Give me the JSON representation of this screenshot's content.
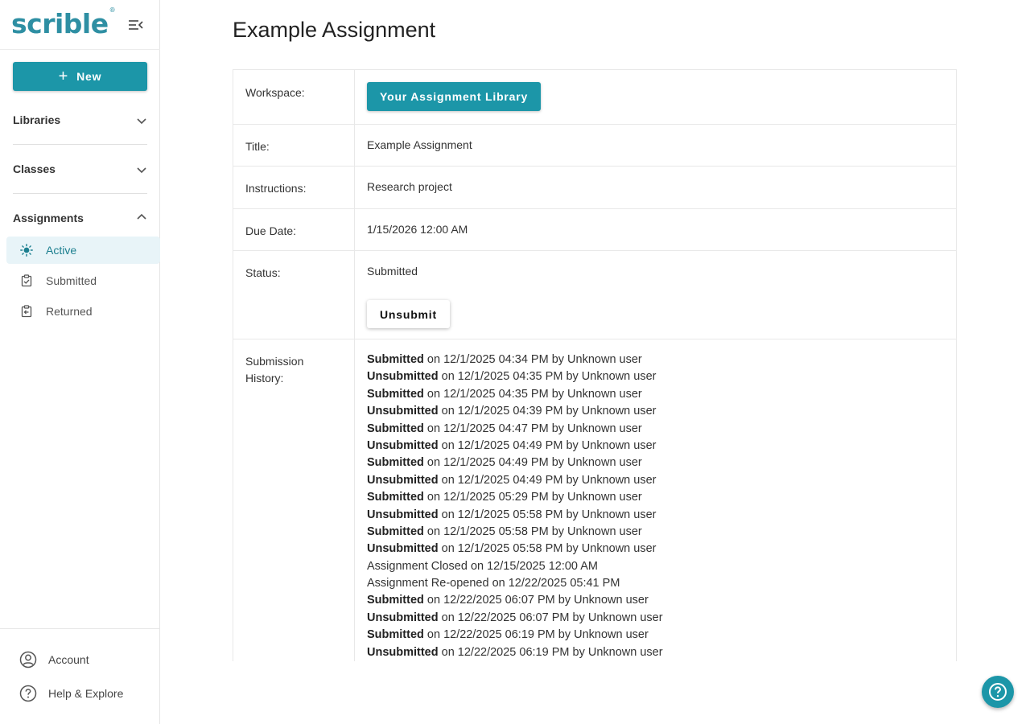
{
  "sidebar": {
    "logo_text": "scrible",
    "logo_mark": "®",
    "new_label": "New",
    "sections": [
      {
        "label": "Libraries"
      },
      {
        "label": "Classes"
      },
      {
        "label": "Assignments"
      }
    ],
    "assignment_items": [
      {
        "label": "Active",
        "icon": "sun-icon",
        "active": true
      },
      {
        "label": "Submitted",
        "icon": "clipboard-check-icon"
      },
      {
        "label": "Returned",
        "icon": "clipboard-return-icon"
      }
    ],
    "bottom": [
      {
        "label": "Account",
        "icon": "account-icon"
      },
      {
        "label": "Help & Explore",
        "icon": "help-icon"
      }
    ]
  },
  "main": {
    "title": "Example Assignment",
    "rows": {
      "workspace_label": "Workspace:",
      "workspace_button": "Your Assignment Library",
      "title_label": "Title:",
      "title_value": "Example Assignment",
      "instructions_label": "Instructions:",
      "instructions_value": "Research project",
      "due_label": "Due Date:",
      "due_value": "1/15/2026 12:00 AM",
      "status_label": "Status:",
      "status_value": "Submitted",
      "unsubmit_button": "Unsubmit",
      "history_label": "Submission History:"
    },
    "history": [
      {
        "action": "Submitted",
        "date": "on 12/1/2025 04:34 PM",
        "by": "by Unknown user",
        "bold": true
      },
      {
        "action": "Unsubmitted",
        "date": "on 12/1/2025 04:35 PM",
        "by": "by Unknown user",
        "bold": true
      },
      {
        "action": "Submitted",
        "date": "on 12/1/2025 04:35 PM",
        "by": "by Unknown user",
        "bold": true
      },
      {
        "action": "Unsubmitted",
        "date": "on 12/1/2025 04:39 PM",
        "by": "by Unknown user",
        "bold": true
      },
      {
        "action": "Submitted",
        "date": "on 12/1/2025 04:47 PM",
        "by": "by Unknown user",
        "bold": true
      },
      {
        "action": "Unsubmitted",
        "date": "on 12/1/2025 04:49 PM",
        "by": "by Unknown user",
        "bold": true
      },
      {
        "action": "Submitted",
        "date": "on 12/1/2025 04:49 PM",
        "by": "by Unknown user",
        "bold": true
      },
      {
        "action": "Unsubmitted",
        "date": "on 12/1/2025 04:49 PM",
        "by": "by Unknown user",
        "bold": true
      },
      {
        "action": "Submitted",
        "date": "on 12/1/2025 05:29 PM",
        "by": "by Unknown user",
        "bold": true
      },
      {
        "action": "Unsubmitted",
        "date": "on 12/1/2025 05:58 PM",
        "by": "by Unknown user",
        "bold": true
      },
      {
        "action": "Submitted",
        "date": "on 12/1/2025 05:58 PM",
        "by": "by Unknown user",
        "bold": true
      },
      {
        "action": "Unsubmitted",
        "date": "on 12/1/2025 05:58 PM",
        "by": "by Unknown user",
        "bold": true
      },
      {
        "action": "Assignment Closed",
        "date": "on 12/15/2025 12:00 AM",
        "by": "",
        "bold": false
      },
      {
        "action": "Assignment Re-opened",
        "date": "on 12/22/2025 05:41 PM",
        "by": "",
        "bold": false
      },
      {
        "action": "Submitted",
        "date": "on 12/22/2025 06:07 PM",
        "by": "by Unknown user",
        "bold": true
      },
      {
        "action": "Unsubmitted",
        "date": "on 12/22/2025 06:07 PM",
        "by": "by Unknown user",
        "bold": true
      },
      {
        "action": "Submitted",
        "date": "on 12/22/2025 06:19 PM",
        "by": "by Unknown user",
        "bold": true
      },
      {
        "action": "Unsubmitted",
        "date": "on 12/22/2025 06:19 PM",
        "by": "by Unknown user",
        "bold": true
      }
    ]
  },
  "colors": {
    "accent": "#1c96a8",
    "logo": "#2e8fa3",
    "active_bg": "#e8f4f8"
  }
}
